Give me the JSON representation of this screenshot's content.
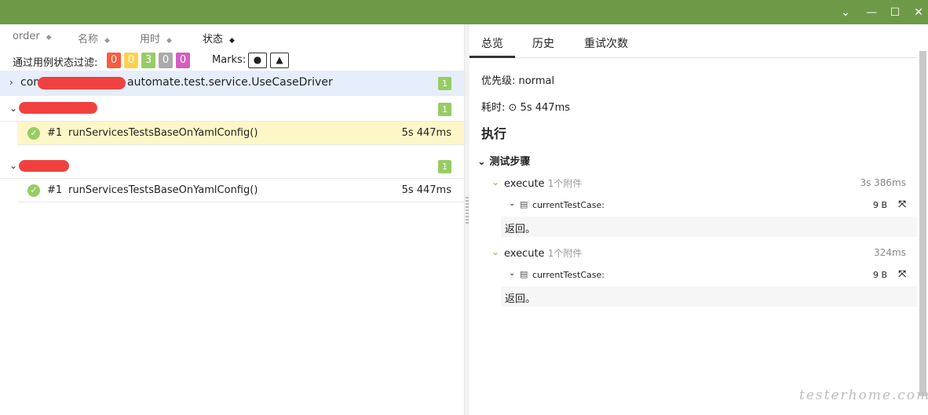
{
  "window": {
    "controls": [
      "chevron-down-icon",
      "minimize-icon",
      "maximize-icon",
      "close-icon"
    ],
    "accent": "#6e9a47"
  },
  "tree": {
    "sort": [
      {
        "label": "order",
        "arrow": "◆"
      },
      {
        "label": "名称",
        "arrow": "◆"
      },
      {
        "label": "用时",
        "arrow": "◆"
      },
      {
        "label": "状态",
        "arrow": "◆"
      }
    ],
    "filter": {
      "label": "通过用例状态过滤:",
      "chips": [
        {
          "value": "0",
          "color": "#fd5a3e"
        },
        {
          "value": "0",
          "color": "#ffd050"
        },
        {
          "value": "3",
          "color": "#97cc64"
        },
        {
          "value": "0",
          "color": "#aaaaaa"
        },
        {
          "value": "0",
          "color": "#d35ebe"
        }
      ],
      "marks_label": "Marks:"
    },
    "groups": [
      {
        "prefix": "com",
        "name": "automate.test.service.UseCaseDriver",
        "count": "1",
        "chevron": "›"
      },
      {
        "name": "",
        "count": "1",
        "chevron": "⌄"
      },
      {
        "name": "",
        "count": "1",
        "chevron": "⌄"
      }
    ],
    "cases": [
      {
        "num": "#1",
        "name": "runServicesTestsBaseOnYamlConfig()",
        "duration": "5s 447ms"
      },
      {
        "num": "#1",
        "name": "runServicesTestsBaseOnYamlConfig()",
        "duration": "5s 447ms"
      }
    ]
  },
  "detail": {
    "tabs": [
      "总览",
      "历史",
      "重试次数"
    ],
    "priority": "优先级: normal",
    "duration_label": "耗时:",
    "duration": "5s 447ms",
    "section": "执行",
    "steps_header": "测试步骤",
    "steps": [
      {
        "name": "execute",
        "attachments": "1个附件",
        "duration": "3s 386ms",
        "attachment": {
          "name": "currentTestCase:",
          "size": "9 B"
        },
        "result": "返回。"
      },
      {
        "name": "execute",
        "attachments": "1个附件",
        "duration": "324ms",
        "attachment": {
          "name": "currentTestCase:",
          "size": "9 B"
        },
        "result": "返回。"
      }
    ]
  },
  "watermark": "testerhome.com"
}
